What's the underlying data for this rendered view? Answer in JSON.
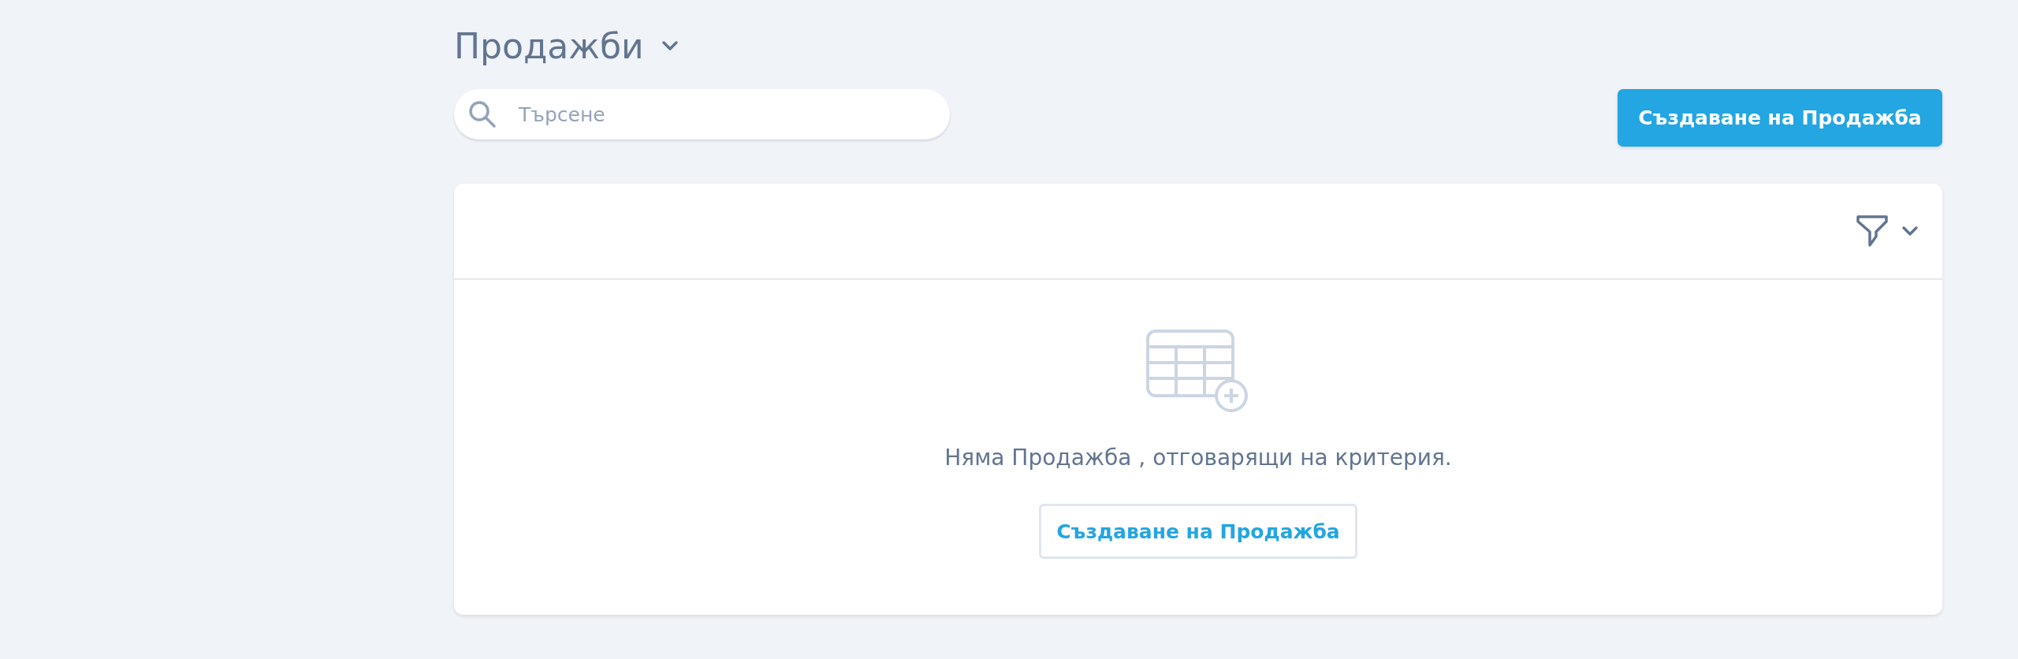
{
  "page": {
    "title": "Продажби"
  },
  "search": {
    "placeholder": "Търсене"
  },
  "create_button": {
    "label": "Създаване на Продажба"
  },
  "card": {
    "empty_message": "Няма Продажба , отговарящи на критерия.",
    "empty_button": {
      "label": "Създаване на Продажба"
    }
  }
}
